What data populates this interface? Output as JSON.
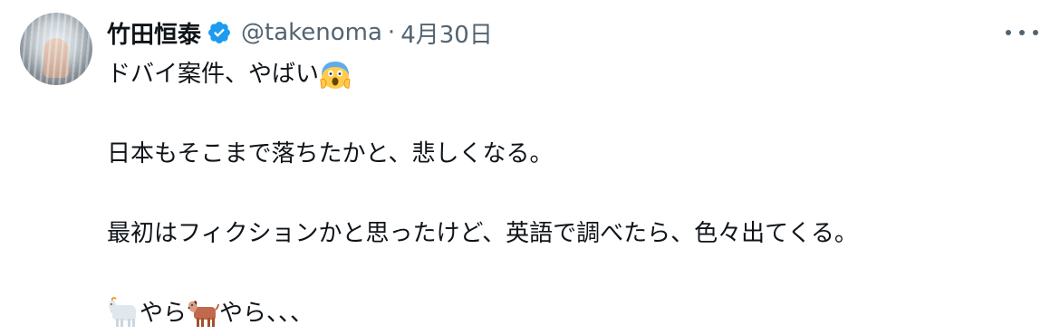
{
  "author": {
    "name": "竹田恒泰",
    "handle": "@takenoma",
    "separator": "·",
    "date": "4月30日",
    "verified": true
  },
  "icons": {
    "avatar": "avatar",
    "verified": "verified-badge-icon",
    "more": "more-options-icon",
    "emoji_scream": "face-screaming-in-fear-emoji",
    "emoji_goat": "goat-emoji",
    "emoji_dog": "dog-emoji"
  },
  "colors": {
    "text": "#0f1419",
    "secondary": "#536471",
    "verified": "#1d9bf0"
  },
  "tweet": {
    "line1": "ドバイ案件、やばい",
    "line2": "日本もそこまで落ちたかと、悲しくなる。",
    "line3": "最初はフィクションかと思ったけど、英語で調べたら、色々出てくる。",
    "line4_a": "やら",
    "line4_b": "やら、、、"
  }
}
